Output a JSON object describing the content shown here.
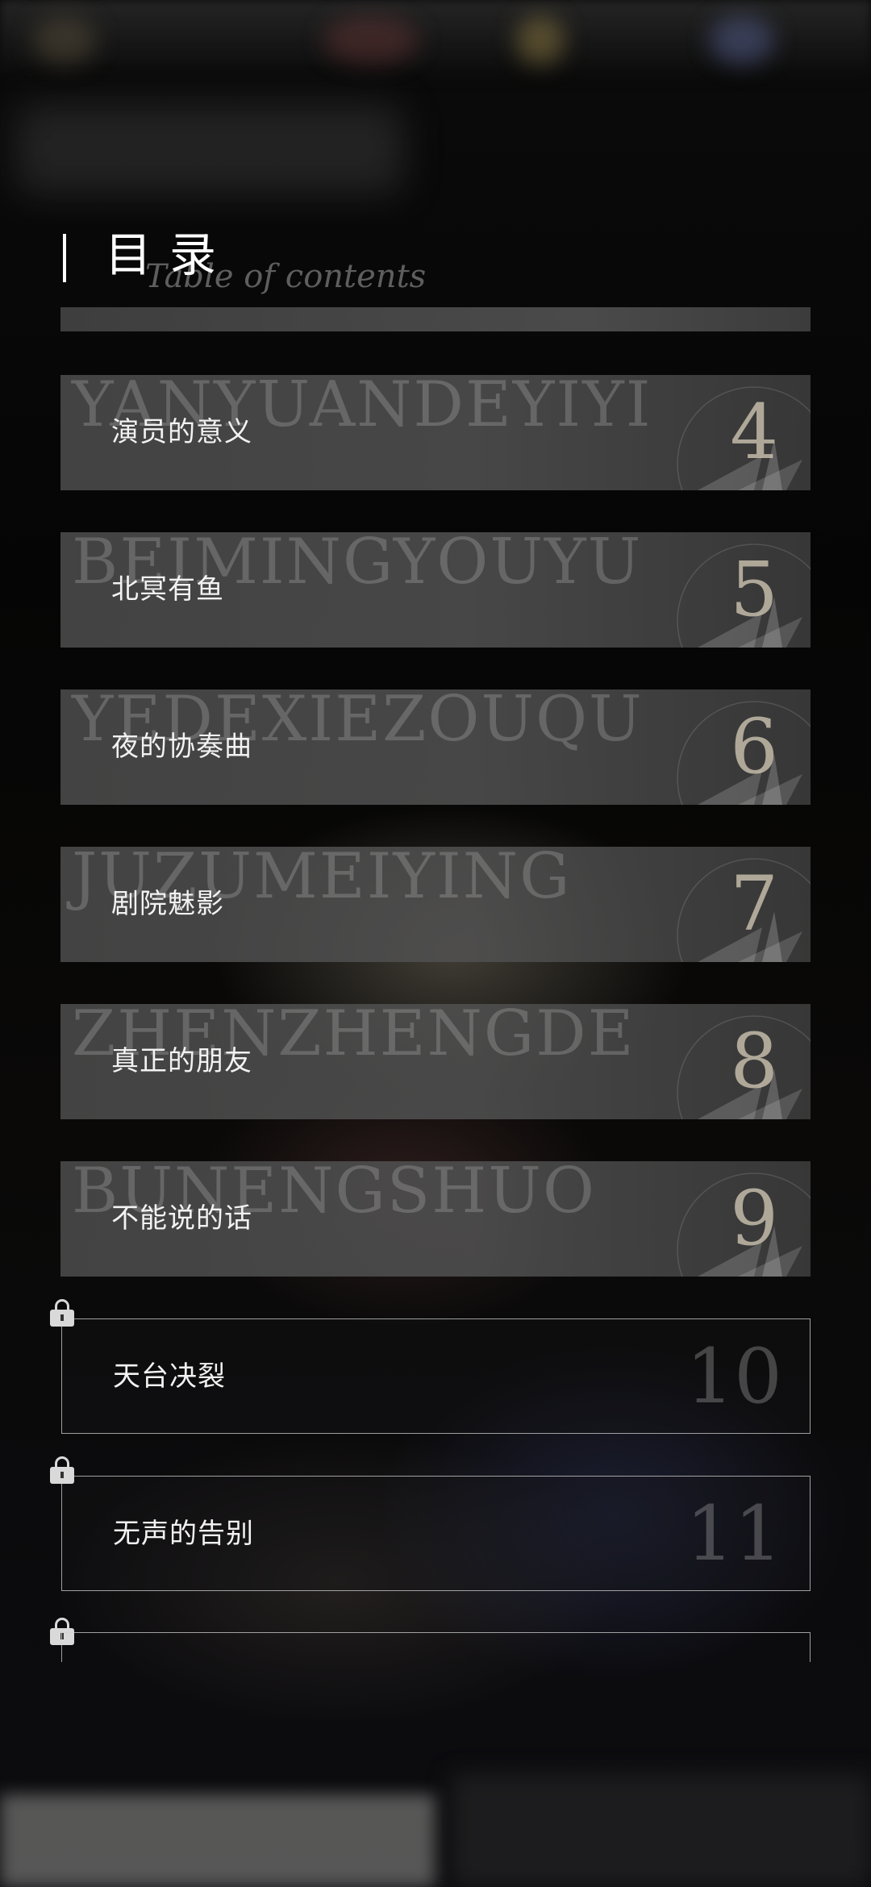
{
  "header": {
    "title": "目录",
    "subtitle": "Table of contents"
  },
  "chapters": [
    {
      "pinyin": "YANYUANDEYIYI",
      "title": "演员的意义",
      "number": "4",
      "locked": false
    },
    {
      "pinyin": "BEIMINGYOUYU",
      "title": "北冥有鱼",
      "number": "5",
      "locked": false
    },
    {
      "pinyin": "YEDEXIEZOUQU",
      "title": "夜的协奏曲",
      "number": "6",
      "locked": false
    },
    {
      "pinyin": "JUZUMEIYING",
      "title": "剧院魅影",
      "number": "7",
      "locked": false
    },
    {
      "pinyin": "ZHENZHENGDE",
      "title": "真正的朋友",
      "number": "8",
      "locked": false
    },
    {
      "pinyin": "BUNENGSHUO",
      "title": "不能说的话",
      "number": "9",
      "locked": false
    },
    {
      "pinyin": "",
      "title": "天台决裂",
      "number": "10",
      "locked": true
    },
    {
      "pinyin": "",
      "title": "无声的告别",
      "number": "11",
      "locked": true
    }
  ],
  "colors": {
    "background": "#050505",
    "card": "#4a4a4a",
    "text": "#f2f2f2",
    "number": "#dcd2be",
    "lock": "#d9d9d9"
  },
  "icons": {
    "lock": "lock-icon",
    "leaf_decoration": "leaf-ornament-icon"
  }
}
